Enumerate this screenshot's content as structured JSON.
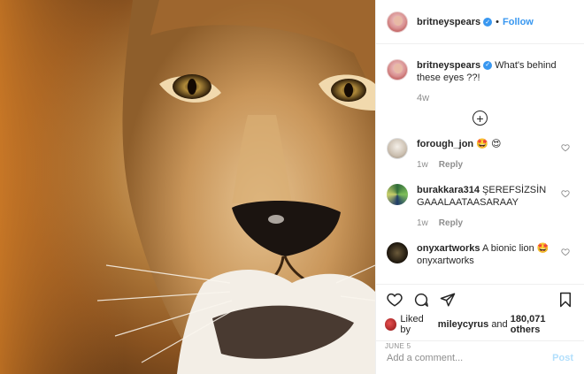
{
  "post": {
    "author": "britneyspears",
    "follow_label": "Follow",
    "separator": "•",
    "verified_mark": "✓"
  },
  "caption": {
    "author": "britneyspears",
    "text": "What's behind these eyes ??!",
    "age": "4w"
  },
  "comments": [
    {
      "user": "forough_jon",
      "text": "🤩 😍",
      "age": "1w",
      "reply_label": "Reply"
    },
    {
      "user": "burakkara314",
      "text": "ŞEREFSİZSİN GAAALAATAASARAAY",
      "age": "1w",
      "reply_label": "Reply"
    },
    {
      "user": "onyxartworks",
      "text": "A bionic lion 🤩 onyxartworks",
      "age": "",
      "reply_label": ""
    }
  ],
  "likes": {
    "prefix": "Liked by",
    "user": "mileycyrus",
    "conjunction": "and",
    "others": "180,071 others"
  },
  "date": "JUNE 5",
  "add_comment": {
    "placeholder": "Add a comment...",
    "post_label": "Post"
  },
  "icons": {
    "like": "heart-icon",
    "comment": "comment-icon",
    "share": "share-icon",
    "save": "bookmark-icon",
    "load_more": "plus-circle-icon"
  },
  "colors": {
    "link": "#3897f0",
    "muted": "#8e8e8e",
    "text": "#262626",
    "post_disabled": "#b2dffc"
  }
}
